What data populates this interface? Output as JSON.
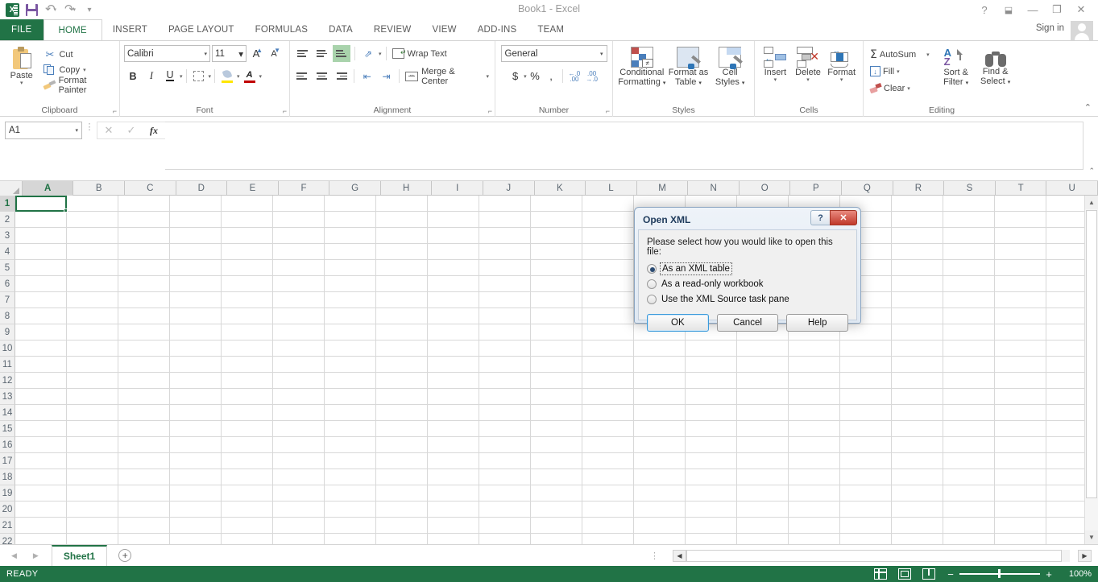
{
  "titlebar": {
    "document_title": "Book1 - Excel",
    "quick_access": [
      {
        "name": "excel-logo",
        "label": "X"
      },
      {
        "name": "save",
        "label": "Save"
      },
      {
        "name": "undo",
        "label": "Undo"
      },
      {
        "name": "redo",
        "label": "Redo"
      },
      {
        "name": "customize-qat",
        "label": "Customize Quick Access Toolbar"
      }
    ],
    "window_buttons": [
      {
        "name": "help",
        "glyph": "?"
      },
      {
        "name": "ribbon-display-options",
        "glyph": "⬓"
      },
      {
        "name": "minimize",
        "glyph": "—"
      },
      {
        "name": "restore",
        "glyph": "❐"
      },
      {
        "name": "close",
        "glyph": "✕"
      }
    ],
    "sign_in": "Sign in"
  },
  "tabs": {
    "file": "FILE",
    "items": [
      {
        "label": "HOME",
        "active": true
      },
      {
        "label": "INSERT",
        "active": false
      },
      {
        "label": "PAGE LAYOUT",
        "active": false
      },
      {
        "label": "FORMULAS",
        "active": false
      },
      {
        "label": "DATA",
        "active": false
      },
      {
        "label": "REVIEW",
        "active": false
      },
      {
        "label": "VIEW",
        "active": false
      },
      {
        "label": "ADD-INS",
        "active": false
      },
      {
        "label": "TEAM",
        "active": false
      }
    ]
  },
  "ribbon": {
    "clipboard": {
      "group_label": "Clipboard",
      "paste": "Paste",
      "cut": "Cut",
      "copy": "Copy",
      "format_painter": "Format Painter"
    },
    "font": {
      "group_label": "Font",
      "font_family": "Calibri",
      "font_size": "11",
      "grow_font": "A",
      "shrink_font": "A",
      "bold": "B",
      "italic": "I",
      "underline": "U"
    },
    "alignment": {
      "group_label": "Alignment",
      "wrap_text": "Wrap Text",
      "merge_center": "Merge & Center"
    },
    "number": {
      "group_label": "Number",
      "format": "General",
      "accounting": "$",
      "percent": "%",
      "comma": ","
    },
    "styles": {
      "group_label": "Styles",
      "conditional_formatting": "Conditional\nFormatting",
      "conditional_formatting_l1": "Conditional",
      "conditional_formatting_l2": "Formatting",
      "format_as_table_l1": "Format as",
      "format_as_table_l2": "Table",
      "cell_styles_l1": "Cell",
      "cell_styles_l2": "Styles"
    },
    "cells": {
      "group_label": "Cells",
      "insert": "Insert",
      "delete": "Delete",
      "format": "Format"
    },
    "editing": {
      "group_label": "Editing",
      "autosum": "AutoSum",
      "fill": "Fill",
      "clear": "Clear",
      "sort_filter_l1": "Sort &",
      "sort_filter_l2": "Filter",
      "find_select_l1": "Find &",
      "find_select_l2": "Select"
    }
  },
  "formula_bar": {
    "name_box": "A1",
    "cancel": "✕",
    "enter": "✓",
    "insert_function": "fx",
    "value": ""
  },
  "grid": {
    "columns": [
      "A",
      "B",
      "C",
      "D",
      "E",
      "F",
      "G",
      "H",
      "I",
      "J",
      "K",
      "L",
      "M",
      "N",
      "O",
      "P",
      "Q",
      "R",
      "S",
      "T",
      "U"
    ],
    "rows": [
      "1",
      "2",
      "3",
      "4",
      "5",
      "6",
      "7",
      "8",
      "9",
      "10",
      "11",
      "12",
      "13",
      "14",
      "15",
      "16",
      "17",
      "18",
      "19",
      "20",
      "21"
    ],
    "selected_cell": "A1",
    "selected_column": "A",
    "selected_row": "1"
  },
  "sheet_bar": {
    "sheets": [
      {
        "name": "Sheet1",
        "active": true
      }
    ],
    "add_sheet": "+"
  },
  "status_bar": {
    "status": "READY",
    "views": [
      "normal-view",
      "page-layout-view",
      "page-break-view"
    ],
    "zoom": "100%",
    "zoom_out": "−",
    "zoom_in": "+"
  },
  "dialog": {
    "title": "Open XML",
    "help_glyph": "?",
    "close_glyph": "✕",
    "prompt": "Please select how you would like to open this file:",
    "options": [
      {
        "label": "As an XML table",
        "selected": true,
        "focused": true
      },
      {
        "label": "As a read-only workbook",
        "selected": false,
        "focused": false
      },
      {
        "label": "Use the XML Source task pane",
        "selected": false,
        "focused": false
      }
    ],
    "buttons": [
      {
        "label": "OK",
        "default": true
      },
      {
        "label": "Cancel",
        "default": false
      },
      {
        "label": "Help",
        "default": false
      }
    ]
  },
  "colors": {
    "excel_green": "#217346",
    "ribbon_border": "#d4d4d4",
    "selection_green": "#217346"
  }
}
